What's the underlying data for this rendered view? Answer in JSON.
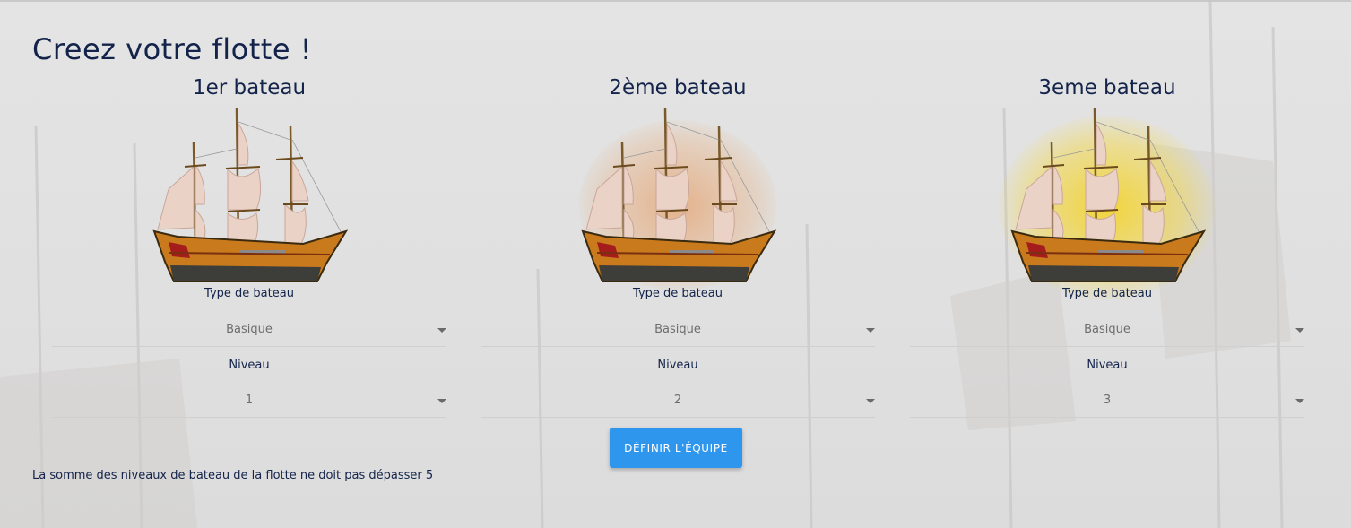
{
  "page": {
    "title": "Creez votre flotte !"
  },
  "boats": [
    {
      "heading": "1er bateau",
      "type_label": "Type de bateau",
      "type_value": "Basique",
      "level_label": "Niveau",
      "level_value": "1",
      "glow": "none"
    },
    {
      "heading": "2ème bateau",
      "type_label": "Type de bateau",
      "type_value": "Basique",
      "level_label": "Niveau",
      "level_value": "2",
      "glow": "#e8a060"
    },
    {
      "heading": "3eme bateau",
      "type_label": "Type de bateau",
      "type_value": "Basique",
      "level_label": "Niveau",
      "level_value": "3",
      "glow": "#f5d21e"
    }
  ],
  "actions": {
    "define_team": "DÉFINIR L'ÉQUIPE"
  },
  "footer": {
    "note": "La somme des niveaux de bateau de la flotte ne doit pas dépasser 5"
  },
  "colors": {
    "primary": "#2f96ee",
    "text": "#13234a"
  }
}
